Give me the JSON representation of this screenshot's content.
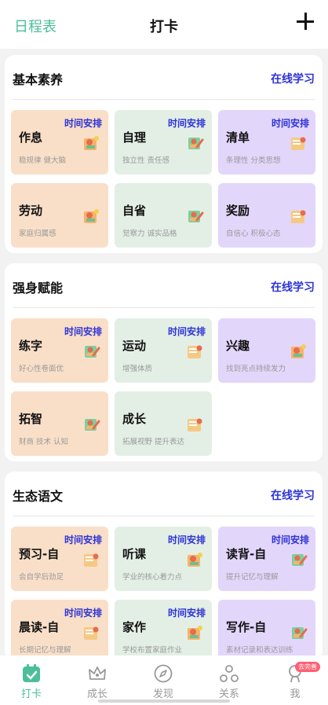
{
  "header": {
    "left_label": "日程表",
    "title": "打卡",
    "add_icon": "plus-icon"
  },
  "sections": [
    {
      "title": "基本素养",
      "link": "在线学习",
      "cards": [
        {
          "name": "作息",
          "tag": "时间安排",
          "desc": "稳规律 健大脑",
          "color": "orange"
        },
        {
          "name": "自理",
          "tag": "时间安排",
          "desc": "独立性 责任感",
          "color": "green"
        },
        {
          "name": "清单",
          "tag": "时间安排",
          "desc": "条理性 分类思想",
          "color": "purple"
        },
        {
          "name": "劳动",
          "tag": "",
          "desc": "家庭归属感",
          "color": "orange"
        },
        {
          "name": "自省",
          "tag": "",
          "desc": "觉察力 诚实品格",
          "color": "green"
        },
        {
          "name": "奖励",
          "tag": "",
          "desc": "自信心 积极心态",
          "color": "purple"
        }
      ]
    },
    {
      "title": "强身赋能",
      "link": "在线学习",
      "cards": [
        {
          "name": "练字",
          "tag": "时间安排",
          "desc": "好心性卷面优",
          "color": "orange"
        },
        {
          "name": "运动",
          "tag": "时间安排",
          "desc": "增强体质",
          "color": "green"
        },
        {
          "name": "兴趣",
          "tag": "",
          "desc": "找到亮点持续发力",
          "color": "purple"
        },
        {
          "name": "拓智",
          "tag": "",
          "desc": "财商 技术 认知",
          "color": "orange"
        },
        {
          "name": "成长",
          "tag": "",
          "desc": "拓展视野 提升表达",
          "color": "green"
        }
      ]
    },
    {
      "title": "生态语文",
      "link": "在线学习",
      "cards": [
        {
          "name": "预习-自",
          "tag": "时间安排",
          "desc": "会自学后劲足",
          "color": "orange"
        },
        {
          "name": "听课",
          "tag": "时间安排",
          "desc": "学业的核心着力点",
          "color": "green"
        },
        {
          "name": "读背-自",
          "tag": "时间安排",
          "desc": "提升记忆与理解",
          "color": "purple"
        },
        {
          "name": "晨读-自",
          "tag": "时间安排",
          "desc": "长期记忆与理解",
          "color": "orange"
        },
        {
          "name": "家作",
          "tag": "时间安排",
          "desc": "学校布置家庭作业",
          "color": "green"
        },
        {
          "name": "写作-自",
          "tag": "",
          "desc": "素材记录和表达训练",
          "color": "purple"
        }
      ]
    }
  ],
  "tabbar": {
    "items": [
      {
        "label": "打卡",
        "icon": "calendar-check-icon",
        "active": true
      },
      {
        "label": "成长",
        "icon": "crown-icon",
        "active": false
      },
      {
        "label": "发现",
        "icon": "compass-icon",
        "active": false
      },
      {
        "label": "关系",
        "icon": "network-icon",
        "active": false
      },
      {
        "label": "我",
        "icon": "profile-icon",
        "active": false,
        "badge": "去完善"
      }
    ]
  },
  "colors": {
    "accent": "#4cbf98",
    "link": "#2d33d6",
    "orange_card": "#f9dfc8",
    "green_card": "#e3efe5",
    "purple_card": "#e3d6fb"
  }
}
